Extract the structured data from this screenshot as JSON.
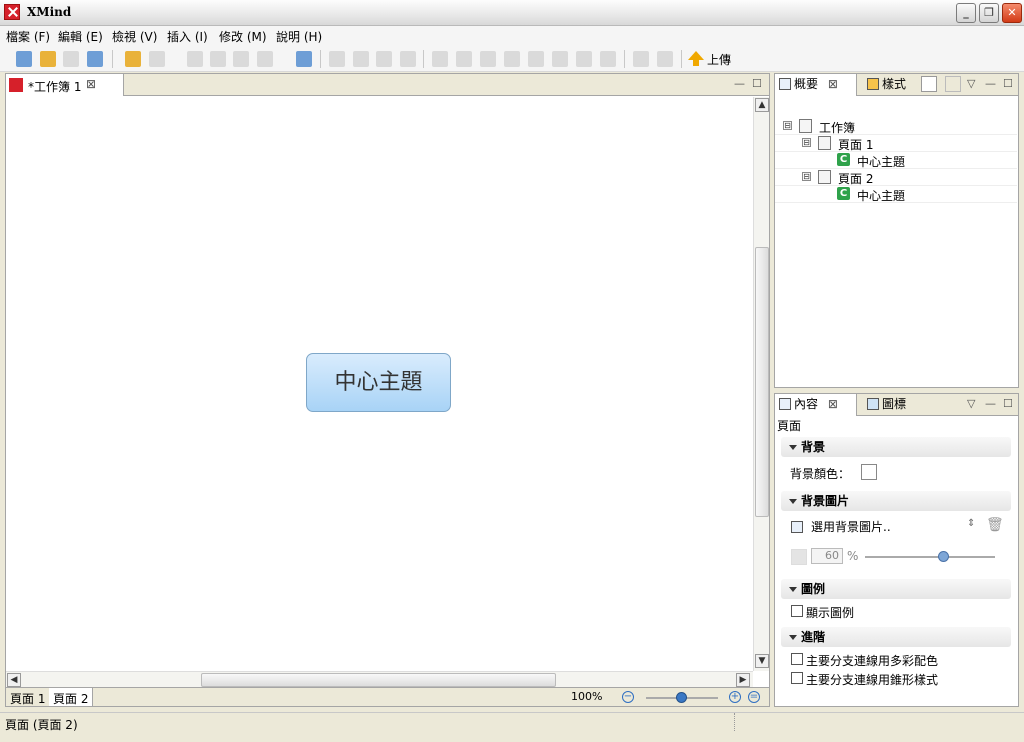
{
  "window": {
    "title": "XMind",
    "min_glyph": "_",
    "max_glyph": "❐",
    "close_glyph": "✕"
  },
  "menu": {
    "items": [
      "檔案 (F)",
      "編輯 (E)",
      "檢視 (V)",
      "插入 (I)",
      "修改 (M)",
      "說明 (H)"
    ]
  },
  "toolbar": {
    "upload_label": "上傳"
  },
  "editor": {
    "tab_title": "*工作簿 1",
    "tab_close": "⊠",
    "central_topic": "中心主題",
    "sheet_tabs": [
      "頁面 1",
      "頁面 2"
    ],
    "active_sheet": "頁面 2",
    "zoom": "100%",
    "zoom_fraction": 0.5
  },
  "outline_panel": {
    "tabs": [
      "概要",
      "樣式"
    ],
    "tree": [
      {
        "level": 0,
        "type": "workbook",
        "label": "工作簿",
        "expander": "⊟"
      },
      {
        "level": 1,
        "type": "sheet",
        "label": "頁面 1",
        "expander": "⊟"
      },
      {
        "level": 2,
        "type": "topic",
        "label": "中心主題",
        "icon_letter": "C"
      },
      {
        "level": 1,
        "type": "sheet",
        "label": "頁面 2",
        "expander": "⊟"
      },
      {
        "level": 2,
        "type": "topic",
        "label": "中心主題",
        "icon_letter": "C"
      }
    ]
  },
  "properties_panel": {
    "tabs": [
      "內容",
      "圖標"
    ],
    "object_label": "頁面",
    "sections": {
      "background": "背景",
      "background_color_label": "背景顏色：",
      "background_image": "背景圖片",
      "select_image": "選用背景圖片..",
      "opacity_value": "60",
      "opacity_unit": "%",
      "opacity_fraction": 0.6,
      "legend": "圖例",
      "show_legend": "顯示圖例",
      "advanced": "進階",
      "multi_color": "主要分支連線用多彩配色",
      "tapered": "主要分支連線用錐形樣式"
    }
  },
  "status": {
    "text": "頁面 (頁面 2)"
  }
}
